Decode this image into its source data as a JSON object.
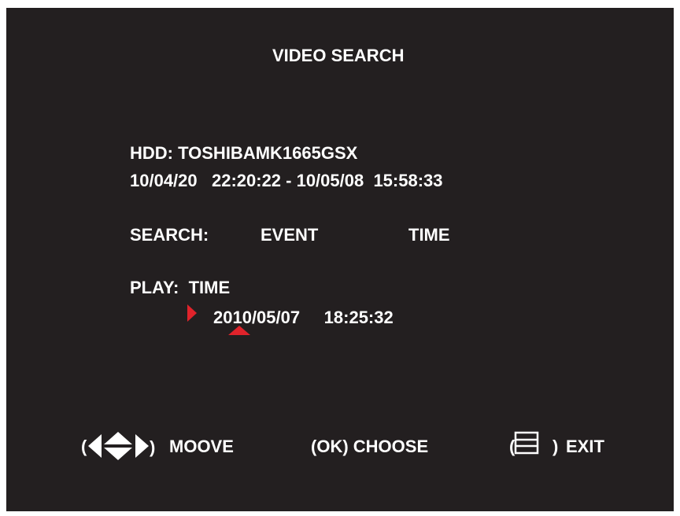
{
  "title": "VIDEO SEARCH",
  "hdd": {
    "label": "HDD: TOSHIBAMK1665GSX",
    "range": "10/04/20   22:20:22 - 10/05/08  15:58:33"
  },
  "search": {
    "label": "SEARCH:",
    "option_event": "EVENT",
    "option_time": "TIME"
  },
  "play": {
    "label": "PLAY:  TIME",
    "datetime": "2010/05/07     18:25:32"
  },
  "footer": {
    "open_paren": "(",
    "close_paren": ")",
    "moove": "MOOVE",
    "choose": "(OK) CHOOSE",
    "exit": "EXIT"
  },
  "colors": {
    "background": "#231f20",
    "text": "#ffffff",
    "cursor": "#e0232b"
  },
  "icons": [
    "arrow-left-icon",
    "arrow-up-down-icon",
    "arrow-right-icon",
    "menu-icon",
    "cursor-right-icon",
    "cursor-up-icon"
  ]
}
